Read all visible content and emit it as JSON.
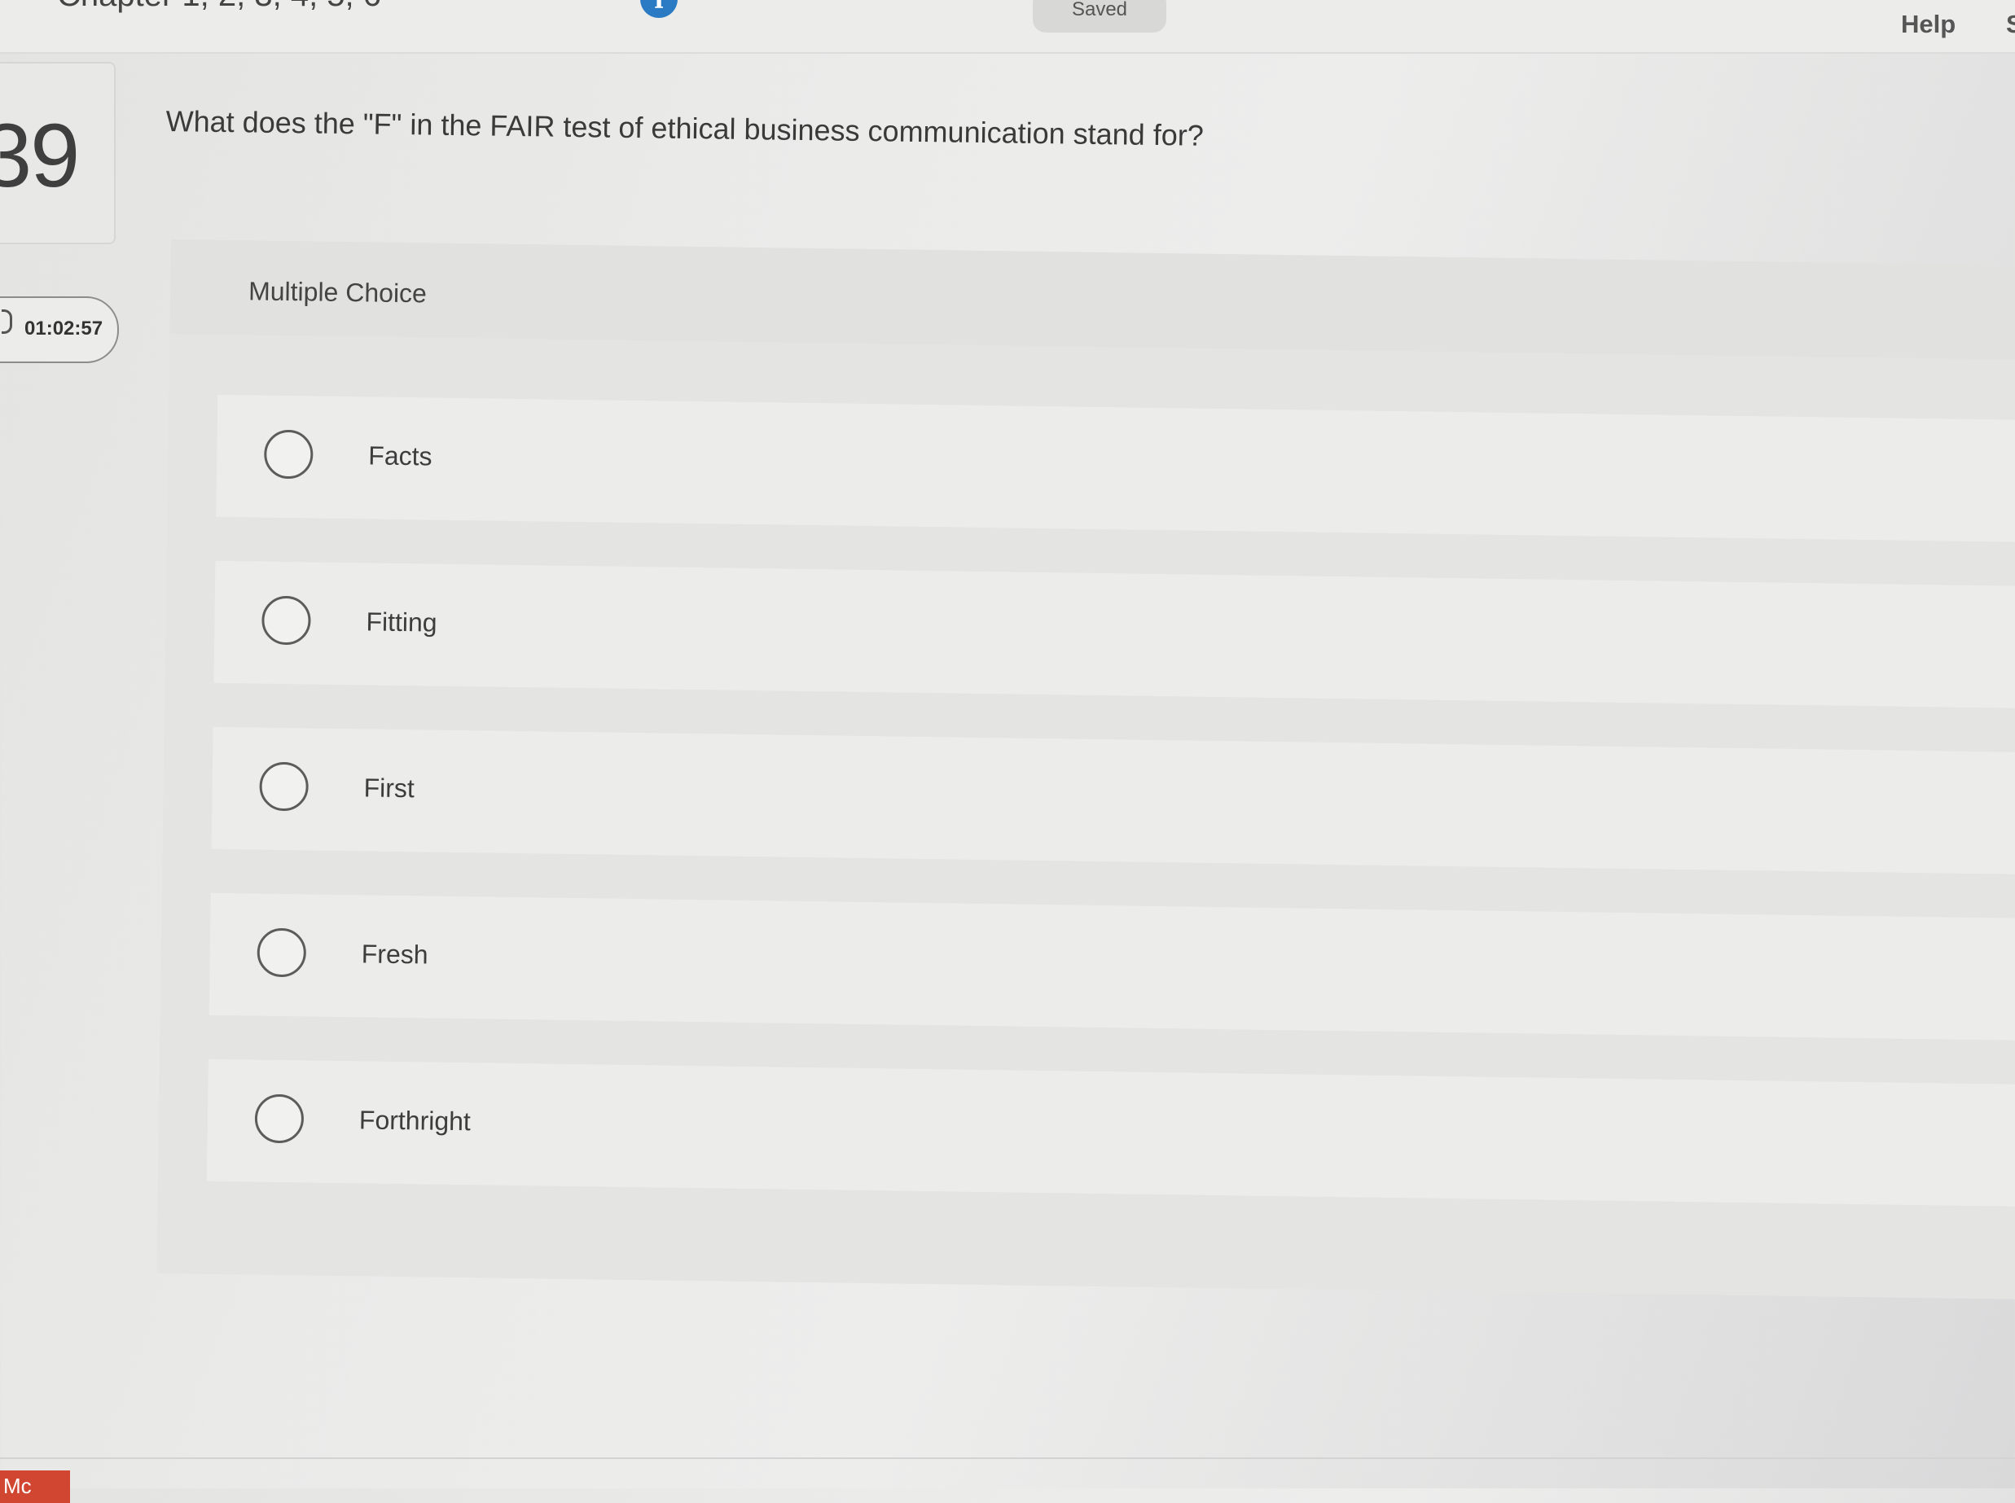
{
  "header": {
    "title": "Chapter 1, 2, 3, 4, 5, 6",
    "info_icon": "info-icon",
    "saved_label": "Saved",
    "help_label": "Help",
    "extra_label": "S"
  },
  "question": {
    "number": "39",
    "timer": "01:02:57",
    "text": "What does the \"F\" in the FAIR test of ethical business communication stand for?",
    "type_label": "Multiple Choice",
    "options": [
      {
        "label": "Facts",
        "selected": false
      },
      {
        "label": "Fitting",
        "selected": false
      },
      {
        "label": "First",
        "selected": false
      },
      {
        "label": "Fresh",
        "selected": false
      },
      {
        "label": "Forthright",
        "selected": false
      }
    ]
  },
  "footer": {
    "logo_text": "Mc"
  },
  "colors": {
    "info_icon_bg": "#2a7bc4",
    "logo_bg": "#d04630"
  }
}
